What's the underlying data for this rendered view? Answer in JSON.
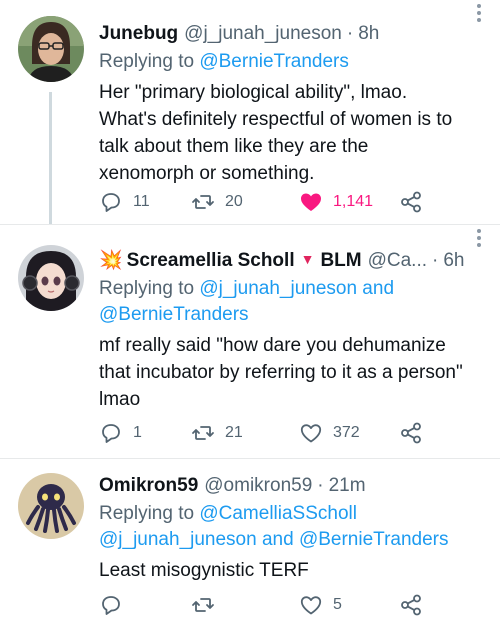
{
  "tweets": [
    {
      "display_name": "Junebug",
      "handle": "@j_junah_juneson",
      "time": "8h",
      "reply_prefix": "Replying to ",
      "reply_to": "@BernieTranders",
      "text": "Her \"primary biological ability\", lmao.\nWhat's definitely respectful of women is to\ntalk about them like they are the\nxenomorph or something.",
      "replies": "11",
      "retweets": "20",
      "likes": "1,141",
      "liked": true,
      "avatar": "photo-avatar"
    },
    {
      "name_emoji": "💥",
      "display_name": "Screamellia Scholl",
      "name_suffix_icon": "red-triangle-icon",
      "name_suffix_text": "BLM",
      "handle": "@Ca...",
      "time": "6h",
      "reply_prefix": "Replying to ",
      "reply_to_1": "@j_junah_juneson",
      "reply_and": " and",
      "reply_to_2": "@BernieTranders",
      "text": "mf really said \"how dare you dehumanize\nthat incubator by referring to it as a person\"\nlmao",
      "replies": "1",
      "retweets": "21",
      "likes": "372",
      "liked": false,
      "avatar": "anime-avatar"
    },
    {
      "display_name": "Omikron59",
      "handle": "@omikron59",
      "time": "21m",
      "reply_prefix": "Replying to ",
      "reply_to_1": "@CamelliaSScholl",
      "reply_to_2": "@j_junah_juneson",
      "reply_and": " and ",
      "reply_to_3": "@BernieTranders",
      "text": "Least misogynistic TERF",
      "replies": "",
      "retweets": "",
      "likes": "5",
      "liked": false,
      "avatar": "octopus-avatar"
    }
  ],
  "separator": "·",
  "colors": {
    "link": "#1d9bf0",
    "secondary_text": "#536471",
    "like_active": "#f91880",
    "thread_line": "#cfd9de"
  }
}
